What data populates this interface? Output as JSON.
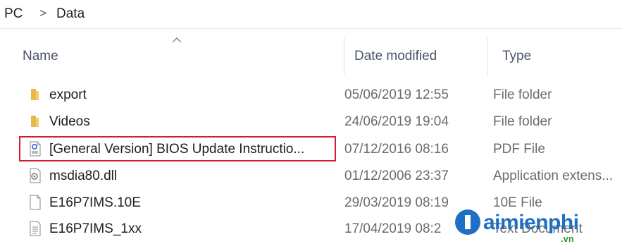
{
  "breadcrumb": {
    "first": "PC",
    "separator": ">",
    "last": "Data"
  },
  "columns": {
    "name": "Name",
    "date": "Date modified",
    "type": "Type"
  },
  "files": [
    {
      "name": "export",
      "date": "05/06/2019 12:55",
      "type": "File folder",
      "icon": "folder-icon"
    },
    {
      "name": "Videos",
      "date": "24/06/2019 19:04",
      "type": "File folder",
      "icon": "folder-icon"
    },
    {
      "name": "[General Version] BIOS Update Instructio...",
      "date": "07/12/2016 08:16",
      "type": "PDF File",
      "icon": "pdf-file-icon"
    },
    {
      "name": "msdia80.dll",
      "date": "01/12/2006 23:37",
      "type": "Application extens...",
      "icon": "dll-file-icon"
    },
    {
      "name": "E16P7IMS.10E",
      "date": "29/03/2019 08:19",
      "type": "10E File",
      "icon": "blank-file-icon"
    },
    {
      "name": "E16P7IMS_1xx",
      "date": "17/04/2019 08:2",
      "type": "Text Document",
      "icon": "text-file-icon"
    }
  ],
  "watermark": {
    "brand": "aimienphi",
    "suffix": ".vn"
  },
  "colors": {
    "highlight": "#d02030",
    "folder": "#e8b84a",
    "watermark": "#1f6fc5"
  }
}
